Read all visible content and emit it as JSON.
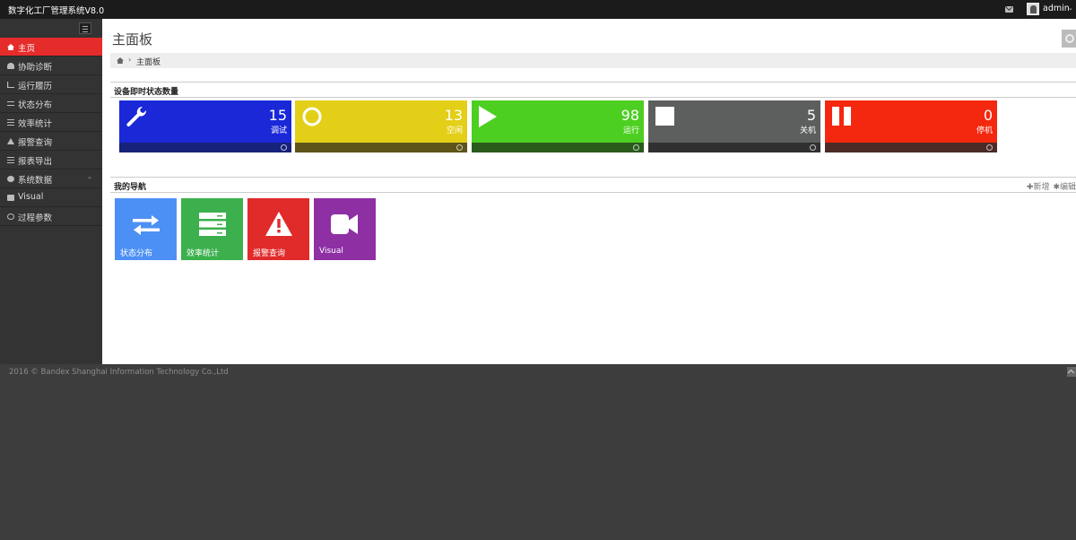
{
  "header": {
    "app_title": "数字化工厂管理系统V8.0",
    "user_name": "admin",
    "user_caret": "⌄"
  },
  "sidebar": {
    "items": [
      {
        "label": "主页",
        "icon": "home-icon",
        "active": true
      },
      {
        "label": "协助诊断",
        "icon": "cloud-icon"
      },
      {
        "label": "运行履历",
        "icon": "chart-icon"
      },
      {
        "label": "状态分布",
        "icon": "swap-icon"
      },
      {
        "label": "效率统计",
        "icon": "list-icon"
      },
      {
        "label": "报警查询",
        "icon": "warning-icon"
      },
      {
        "label": "报表导出",
        "icon": "list-icon"
      },
      {
        "label": "系统数据",
        "icon": "cogs-icon",
        "expandable": true
      },
      {
        "label": "Visual",
        "icon": "video-camera-icon"
      },
      {
        "label": "过程参数",
        "icon": "refresh-icon"
      }
    ],
    "expand_caret": "⌄"
  },
  "main": {
    "page_title": "主面板",
    "breadcrumb": {
      "separator": "›",
      "current": "主面板"
    }
  },
  "status_section": {
    "title": "设备即时状态数量",
    "tiles": [
      {
        "value": "15",
        "label": "调试",
        "icon": "wrench-icon",
        "color": "#1a28d8",
        "footer_color": "#17227a"
      },
      {
        "value": "13",
        "label": "空闲",
        "icon": "circle-icon",
        "color": "#e4cf18",
        "footer_color": "#5e5419"
      },
      {
        "value": "98",
        "label": "运行",
        "icon": "play-icon",
        "color": "#4dcf22",
        "footer_color": "#2a5a1c"
      },
      {
        "value": "5",
        "label": "关机",
        "icon": "stop-icon",
        "color": "#5d5f5e",
        "footer_color": "#2f302f"
      },
      {
        "value": "0",
        "label": "停机",
        "icon": "pause-icon",
        "color": "#f4280f",
        "footer_color": "#4c2a26"
      }
    ]
  },
  "nav_section": {
    "title": "我的导航",
    "add_label": "✚新增",
    "edit_label": "✱编辑",
    "tiles": [
      {
        "label": "状态分布",
        "icon": "exchange-arrows-icon",
        "color": "#4d90f5"
      },
      {
        "label": "效率统计",
        "icon": "server-list-icon",
        "color": "#3cb04d"
      },
      {
        "label": "报警查询",
        "icon": "warning-icon",
        "color": "#e12b2b"
      },
      {
        "label": "Visual",
        "icon": "video-camera-icon",
        "color": "#8e2fa4"
      }
    ]
  },
  "footer": {
    "copyright": "2016 © Bandex Shanghai Information Technology Co.,Ltd"
  }
}
